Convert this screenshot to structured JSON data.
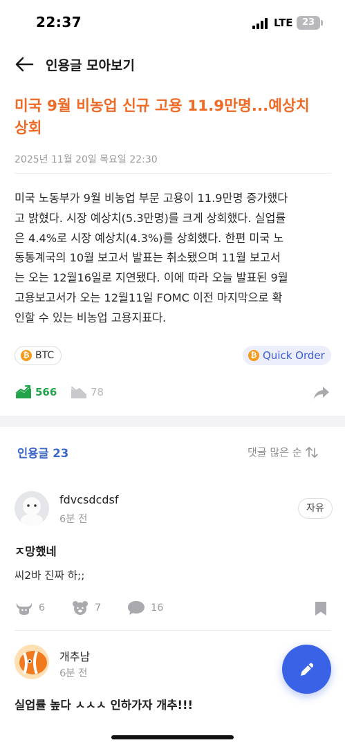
{
  "status_bar": {
    "time": "22:37",
    "network": "LTE",
    "battery": "23"
  },
  "header": {
    "title": "인용글 모아보기"
  },
  "article": {
    "title_line1": "미국 9월 비농업 신규 고용 11.9만명...예상치",
    "title_line2": "상회",
    "date": "2025년 11월 20일 목요일 22:30",
    "body_lines": [
      "미국 노동부가 9월 비농업 부문 고용이 11.9만명 증가했다",
      "고 밝혔다. 시장 예상치(5.3만명)를 크게 상회했다. 실업률",
      "은 4.4%로 시장 예상치(4.3%)를 상회했다. 한편 미국 노",
      "동통계국의 10월 보고서 발표는 취소됐으며 11월 보고서",
      "는 오는 12월16일로 지연됐다. 이에 따라 오늘 발표된 9월",
      "고용보고서가 오는 12월11일 FOMC 이전 마지막으로 확",
      "인할 수 있는 비농업 고용지표다."
    ],
    "coin_symbol": "₿",
    "ticker": "BTC",
    "quick_order": "Quick Order",
    "likes": "566",
    "dislikes": "78"
  },
  "comments_section": {
    "count_label": "인용글 23",
    "sort_label": "댓글 많은 순"
  },
  "comments": [
    {
      "user": "fdvcsdcdsf",
      "time": "6분 전",
      "tag": "자유",
      "title": "ㅈ망했네",
      "text": "씨2바 진짜 하;;",
      "bull": "6",
      "bear": "7",
      "replies": "16"
    },
    {
      "user": "개추남",
      "time": "6분 전",
      "title": "실업률 높다 ㅅㅅㅅ 인하가자 개추!!!"
    }
  ],
  "colors": {
    "accent_orange": "#ee6a26",
    "link_blue": "#3b68c7",
    "up_green": "#22a34a",
    "fab_blue": "#3a62e6",
    "btc_orange": "#f49a1c"
  }
}
